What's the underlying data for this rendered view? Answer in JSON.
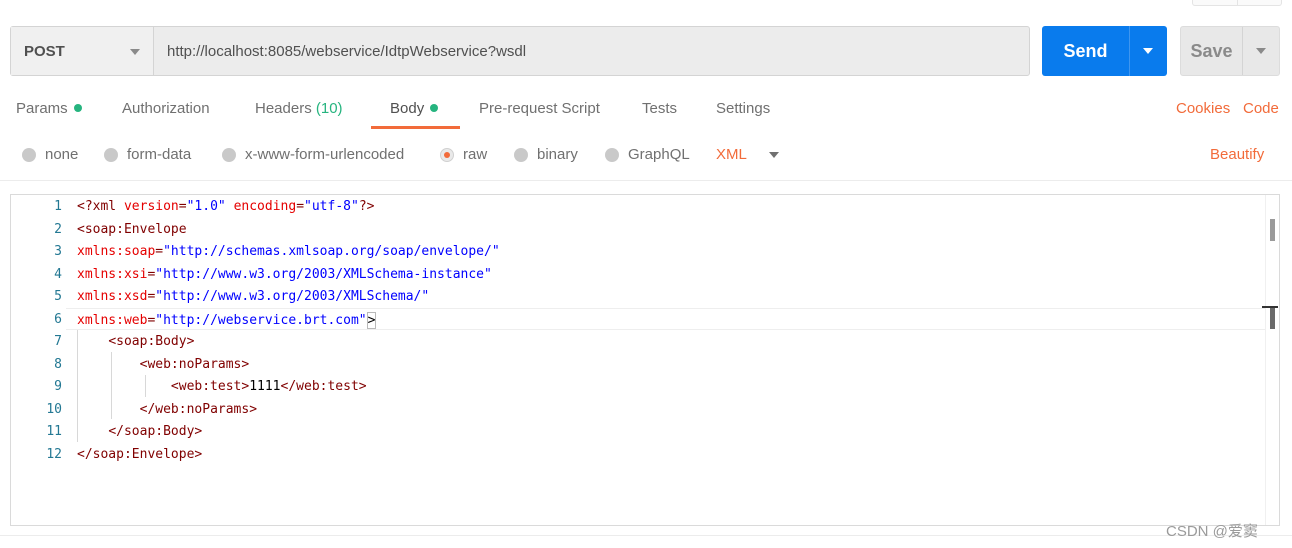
{
  "request": {
    "method": "POST",
    "url": "http://localhost:8085/webservice/IdtpWebservice?wsdl",
    "send_label": "Send",
    "save_label": "Save"
  },
  "tabs": {
    "params": "Params",
    "authorization": "Authorization",
    "headers": "Headers",
    "headers_count": "(10)",
    "body": "Body",
    "prerequest": "Pre-request Script",
    "tests": "Tests",
    "settings": "Settings",
    "active": "Body"
  },
  "links": {
    "cookies": "Cookies",
    "code": "Code",
    "beautify": "Beautify"
  },
  "body_options": {
    "none": "none",
    "form_data": "form-data",
    "urlencoded": "x-www-form-urlencoded",
    "raw": "raw",
    "binary": "binary",
    "graphql": "GraphQL",
    "selected": "raw",
    "format": "XML"
  },
  "editor": {
    "line_numbers": [
      "1",
      "2",
      "3",
      "4",
      "5",
      "6",
      "7",
      "8",
      "9",
      "10",
      "11",
      "12"
    ],
    "lines": [
      {
        "indent": "",
        "parts": [
          [
            "pi",
            "<?xml"
          ],
          [
            "text",
            " "
          ],
          [
            "attr",
            "version"
          ],
          [
            "delim",
            "="
          ],
          [
            "val",
            "\"1.0\""
          ],
          [
            "text",
            " "
          ],
          [
            "attr",
            "encoding"
          ],
          [
            "delim",
            "="
          ],
          [
            "val",
            "\"utf-8\""
          ],
          [
            "pi",
            "?>"
          ]
        ]
      },
      {
        "indent": "",
        "parts": [
          [
            "delim",
            "<"
          ],
          [
            "tag",
            "soap:Envelope"
          ]
        ]
      },
      {
        "indent": "",
        "parts": [
          [
            "attr",
            "xmlns:soap"
          ],
          [
            "delim",
            "="
          ],
          [
            "val",
            "\"http://schemas.xmlsoap.org/soap/envelope/\""
          ]
        ]
      },
      {
        "indent": "",
        "parts": [
          [
            "attr",
            "xmlns:xsi"
          ],
          [
            "delim",
            "="
          ],
          [
            "val",
            "\"http://www.w3.org/2003/XMLSchema-instance\""
          ]
        ]
      },
      {
        "indent": "",
        "parts": [
          [
            "attr",
            "xmlns:xsd"
          ],
          [
            "delim",
            "="
          ],
          [
            "val",
            "\"http://www.w3.org/2003/XMLSchema/\""
          ]
        ]
      },
      {
        "indent": "",
        "parts": [
          [
            "attr",
            "xmlns:web"
          ],
          [
            "delim",
            "="
          ],
          [
            "val",
            "\"http://webservice.brt.com\""
          ],
          [
            "brk",
            ">"
          ]
        ]
      },
      {
        "indent": "    ",
        "parts": [
          [
            "delim",
            "<"
          ],
          [
            "tag",
            "soap:Body"
          ],
          [
            "delim",
            ">"
          ]
        ]
      },
      {
        "indent": "        ",
        "parts": [
          [
            "delim",
            "<"
          ],
          [
            "tag",
            "web:noParams"
          ],
          [
            "delim",
            ">"
          ]
        ]
      },
      {
        "indent": "            ",
        "parts": [
          [
            "delim",
            "<"
          ],
          [
            "tag",
            "web:test"
          ],
          [
            "delim",
            ">"
          ],
          [
            "text",
            "1111"
          ],
          [
            "delim",
            "</"
          ],
          [
            "tag",
            "web:test"
          ],
          [
            "delim",
            ">"
          ]
        ]
      },
      {
        "indent": "        ",
        "parts": [
          [
            "delim",
            "</"
          ],
          [
            "tag",
            "web:noParams"
          ],
          [
            "delim",
            ">"
          ]
        ]
      },
      {
        "indent": "    ",
        "parts": [
          [
            "delim",
            "</"
          ],
          [
            "tag",
            "soap:Body"
          ],
          [
            "delim",
            ">"
          ]
        ]
      },
      {
        "indent": "",
        "parts": [
          [
            "delim",
            "</"
          ],
          [
            "tag",
            "soap:Envelope"
          ],
          [
            "delim",
            ">"
          ]
        ]
      }
    ]
  },
  "watermark": "CSDN @爱窦",
  "colors": {
    "accent_orange": "#f26b3a",
    "send_blue": "#097bed",
    "status_green": "#26b47f"
  }
}
